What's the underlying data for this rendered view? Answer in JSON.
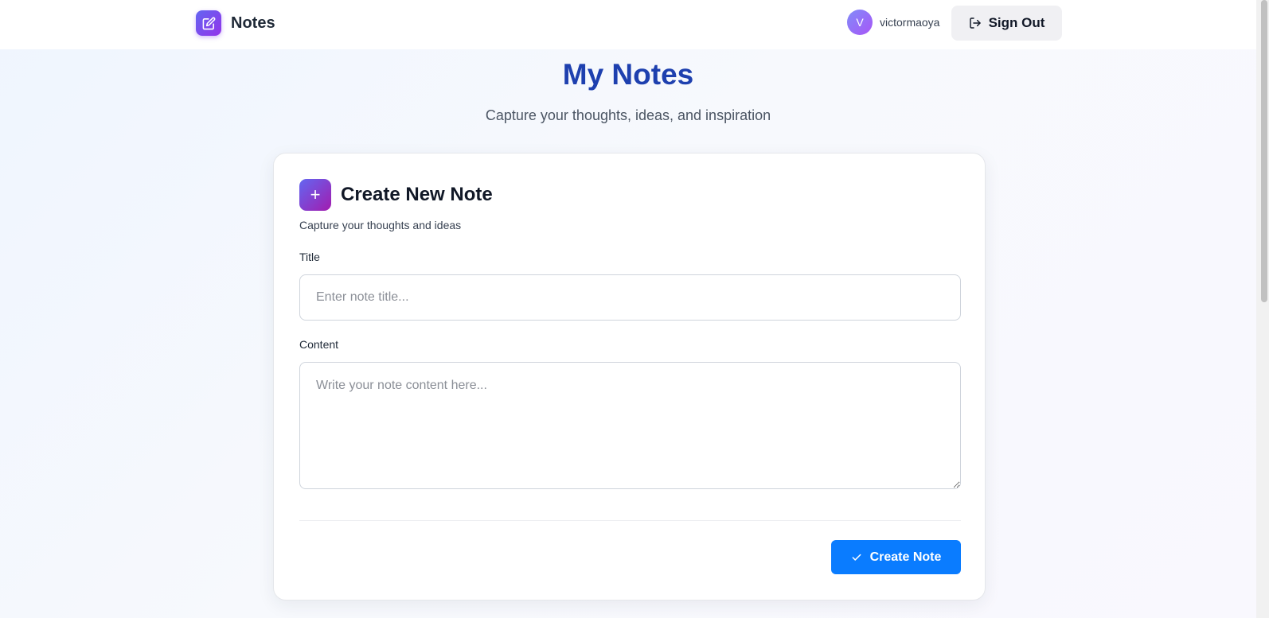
{
  "header": {
    "brand_name": "Notes",
    "brand_icon": "edit-icon",
    "user": {
      "avatar_initial": "V",
      "username": "victormaoya"
    },
    "sign_out_label": "Sign Out",
    "sign_out_icon": "log-out-icon"
  },
  "page": {
    "title": "My Notes",
    "subtitle": "Capture your thoughts, ideas, and inspiration"
  },
  "create_form": {
    "icon": "plus-icon",
    "plus_glyph": "+",
    "title": "Create New Note",
    "subtitle": "Capture your thoughts and ideas",
    "title_label": "Title",
    "title_value": "",
    "title_placeholder": "Enter note title...",
    "content_label": "Content",
    "content_value": "",
    "content_placeholder": "Write your note content here...",
    "submit_label": "Create Note",
    "submit_icon": "check-icon"
  },
  "colors": {
    "brand_gradient": [
      "#6366f1",
      "#9333ea"
    ],
    "title_blue": "#1e40af",
    "primary_button": "#0a7cff"
  }
}
